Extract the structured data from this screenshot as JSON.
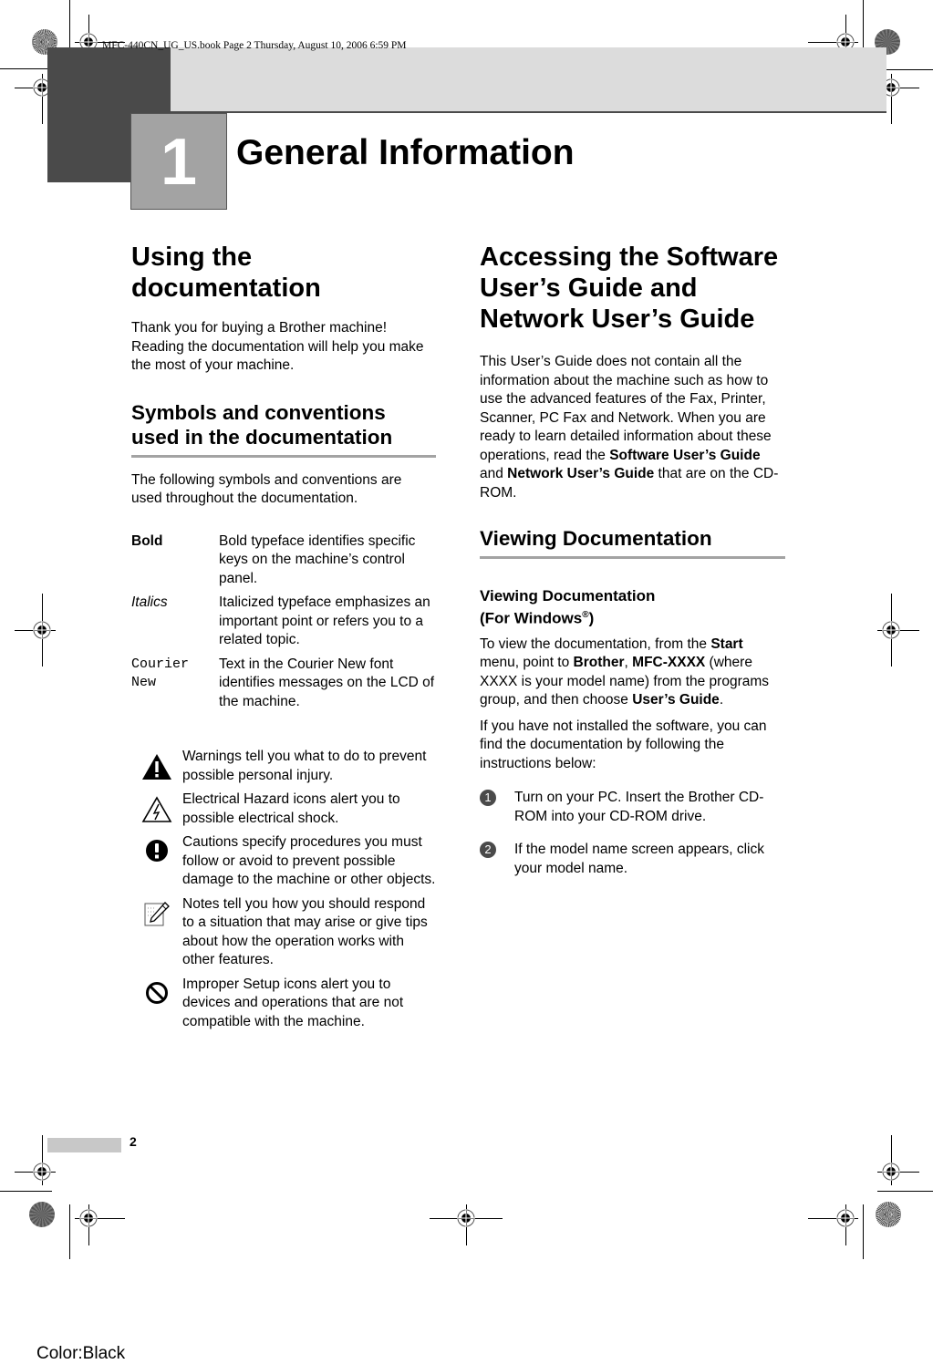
{
  "slug": "MFC-440CN_UG_US.book  Page 2  Thursday, August 10, 2006  6:59 PM",
  "chapter": {
    "number": "1",
    "title": "General Information"
  },
  "left_column": {
    "section_title_line1": "Using the",
    "section_title_line2": "documentation",
    "intro": "Thank you for buying a Brother machine! Reading the documentation will help you make the most of your machine.",
    "subsection_title": "Symbols and conventions used in the documentation",
    "subsection_intro": "The following symbols and conventions are used throughout the documentation.",
    "conventions": [
      {
        "term": "Bold",
        "style": "bold",
        "description": "Bold typeface identifies specific keys on the machine’s control panel."
      },
      {
        "term": "Italics",
        "style": "italic",
        "description": "Italicized typeface emphasizes an important point or refers you to a related topic."
      },
      {
        "term": "Courier New",
        "style": "mono",
        "description": "Text in the Courier New font identifies messages on the LCD of the machine."
      }
    ],
    "icons": [
      {
        "icon": "warning-icon",
        "text": "Warnings tell you what to do to prevent possible personal injury."
      },
      {
        "icon": "electrical-hazard-icon",
        "text": "Electrical Hazard icons alert you to possible electrical shock."
      },
      {
        "icon": "caution-icon",
        "text": "Cautions specify procedures you must follow or avoid to prevent possible damage to the machine or other objects."
      },
      {
        "icon": "note-icon",
        "text": "Notes tell you how you should respond to a situation that may arise or give tips about how the operation works with other features."
      },
      {
        "icon": "improper-setup-icon",
        "text": "Improper Setup icons alert you to devices and operations that are not compatible with the machine."
      }
    ]
  },
  "right_column": {
    "section_title": "Accessing the Software User’s Guide and Network User’s Guide",
    "intro_part1": "This User’s Guide does not contain all the information about the machine such as how to use the advanced features of the Fax, Printer, Scanner, PC Fax and Network. When you are ready to learn detailed information about these operations, read the ",
    "intro_bold1": "Software User’s Guide",
    "intro_part2": " and ",
    "intro_bold2": "Network User’s Guide",
    "intro_part3": " that are on the CD-ROM.",
    "subsection_title": "Viewing Documentation",
    "subsubsection_title_line1": "Viewing Documentation",
    "subsubsection_title_line2": "(For Windows",
    "registered_mark": "®",
    "subsubsection_title_close": ")",
    "view_p1": "To view the documentation, from the ",
    "view_b1": "Start",
    "view_p2": " menu, point to ",
    "view_b2": "Brother",
    "view_p3": ", ",
    "view_b3": "MFC-XXXX",
    "view_p4": " (where XXXX is your model name) from the programs group, and then choose ",
    "view_b4": "User’s Guide",
    "view_p5": ".",
    "not_installed": "If you have not installed the software, you can find the documentation by following the instructions below:",
    "steps": [
      {
        "num": "1",
        "text": "Turn on your PC. Insert the Brother CD-ROM into your CD-ROM drive."
      },
      {
        "num": "2",
        "text": "If the model name screen appears, click your model name."
      }
    ]
  },
  "footer": {
    "page_number": "2",
    "color_label": "Color:Black"
  }
}
